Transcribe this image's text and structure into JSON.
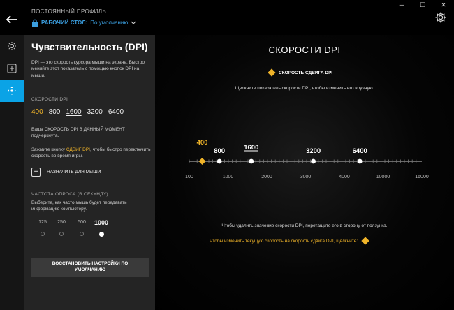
{
  "profile": {
    "label": "ПОСТОЯННЫЙ ПРОФИЛЬ",
    "workspace": "РАБОЧИЙ СТОЛ:",
    "name": "По умолчанию"
  },
  "panel": {
    "title": "Чувствительность (DPI)",
    "description": "DPI — это скорость курсора мыши на экране. Быстро меняйте этот показатель с помощью кнопок DPI на мыши.",
    "dpi_speeds_label": "СКОРОСТИ DPI",
    "dpi_values": [
      "400",
      "800",
      "1600",
      "3200",
      "6400"
    ],
    "current_note": "Ваша СКОРОСТЬ DPI В ДАННЫЙ МОМЕНТ подчеркнута.",
    "shift_note_before": "Зажмите кнопку ",
    "shift_note_link": "СДВИГ DPI",
    "shift_note_after": ", чтобы быстро переключить скорость во время игры.",
    "assign_label": "НАЗНАЧИТЬ ДЛЯ МЫШИ",
    "rate_label": "ЧАСТОТА ОПРОСА (В СЕКУНДУ)",
    "rate_desc": "Выберите, как часто мышь будет передавать информацию компьютеру.",
    "rates": [
      "125",
      "250",
      "500",
      "1000"
    ],
    "restore_label": "ВОССТАНОВИТЬ НАСТРОЙКИ ПО УМОЛЧАНИЮ"
  },
  "main": {
    "title": "СКОРОСТИ DPI",
    "legend": "СКОРОСТЬ СДВИГА DPI",
    "instruction": "Щелкните показатель скорости DPI, чтобы изменить его вручную.",
    "footer1": "Чтобы удалить значение скорости DPI, перетащите его в сторону от ползунка.",
    "footer2": "Чтобы изменить текущую скорость на скорость сдвига DPI, щелкните:"
  },
  "chart_data": {
    "type": "scatter",
    "scale": "non-linear",
    "ticks": [
      100,
      1000,
      2000,
      3000,
      4000,
      10000,
      16000
    ],
    "tick_labels": [
      "100",
      "1000",
      "2000",
      "3000",
      "4000",
      "10000",
      "16000"
    ],
    "points": [
      {
        "label": "400",
        "value": 400,
        "kind": "shift"
      },
      {
        "label": "800",
        "value": 800,
        "kind": "normal"
      },
      {
        "label": "1600",
        "value": 1600,
        "kind": "current"
      },
      {
        "label": "3200",
        "value": 3200,
        "kind": "normal"
      },
      {
        "label": "6400",
        "value": 6400,
        "kind": "normal"
      }
    ],
    "colors": {
      "shift": "#f0b429",
      "normal": "#ffffff",
      "track": "#888888"
    }
  }
}
